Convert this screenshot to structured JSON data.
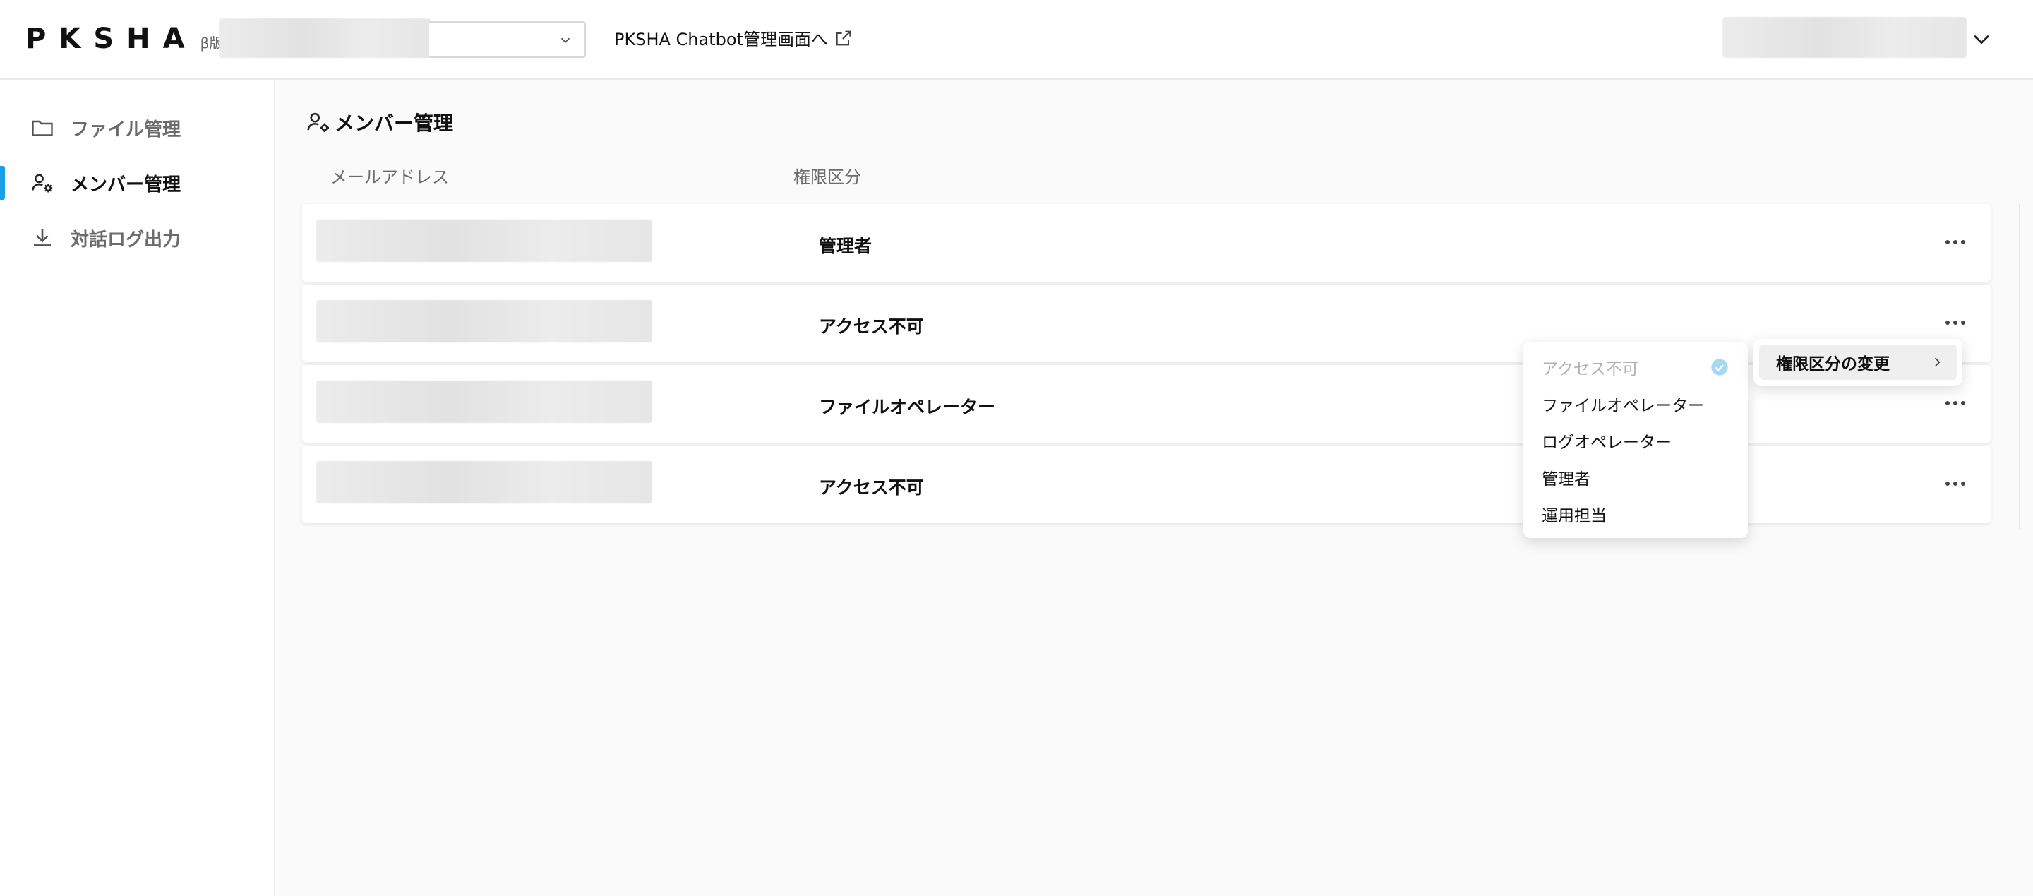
{
  "header": {
    "logo": "PKSHA",
    "logo_badge": "β版",
    "chatbot_link": "PKSHA Chatbot管理画面へ"
  },
  "sidebar": {
    "items": [
      {
        "label": "ファイル管理",
        "icon": "folder-icon",
        "active": false
      },
      {
        "label": "メンバー管理",
        "icon": "user-settings-icon",
        "active": true
      },
      {
        "label": "対話ログ出力",
        "icon": "download-icon",
        "active": false
      }
    ]
  },
  "main": {
    "title": "メンバー管理",
    "columns": {
      "email": "メールアドレス",
      "role": "権限区分"
    },
    "rows": [
      {
        "role": "管理者"
      },
      {
        "role": "アクセス不可"
      },
      {
        "role": "ファイルオペレーター"
      },
      {
        "role": "アクセス不可"
      }
    ]
  },
  "context_menu": {
    "item": "権限区分の変更"
  },
  "role_menu": {
    "options": [
      {
        "label": "アクセス不可",
        "selected": true
      },
      {
        "label": "ファイルオペレーター",
        "selected": false
      },
      {
        "label": "ログオペレーター",
        "selected": false
      },
      {
        "label": "管理者",
        "selected": false
      },
      {
        "label": "運用担当",
        "selected": false
      }
    ]
  },
  "colors": {
    "accent": "#1aa0e6",
    "check": "#a7d8f3"
  }
}
